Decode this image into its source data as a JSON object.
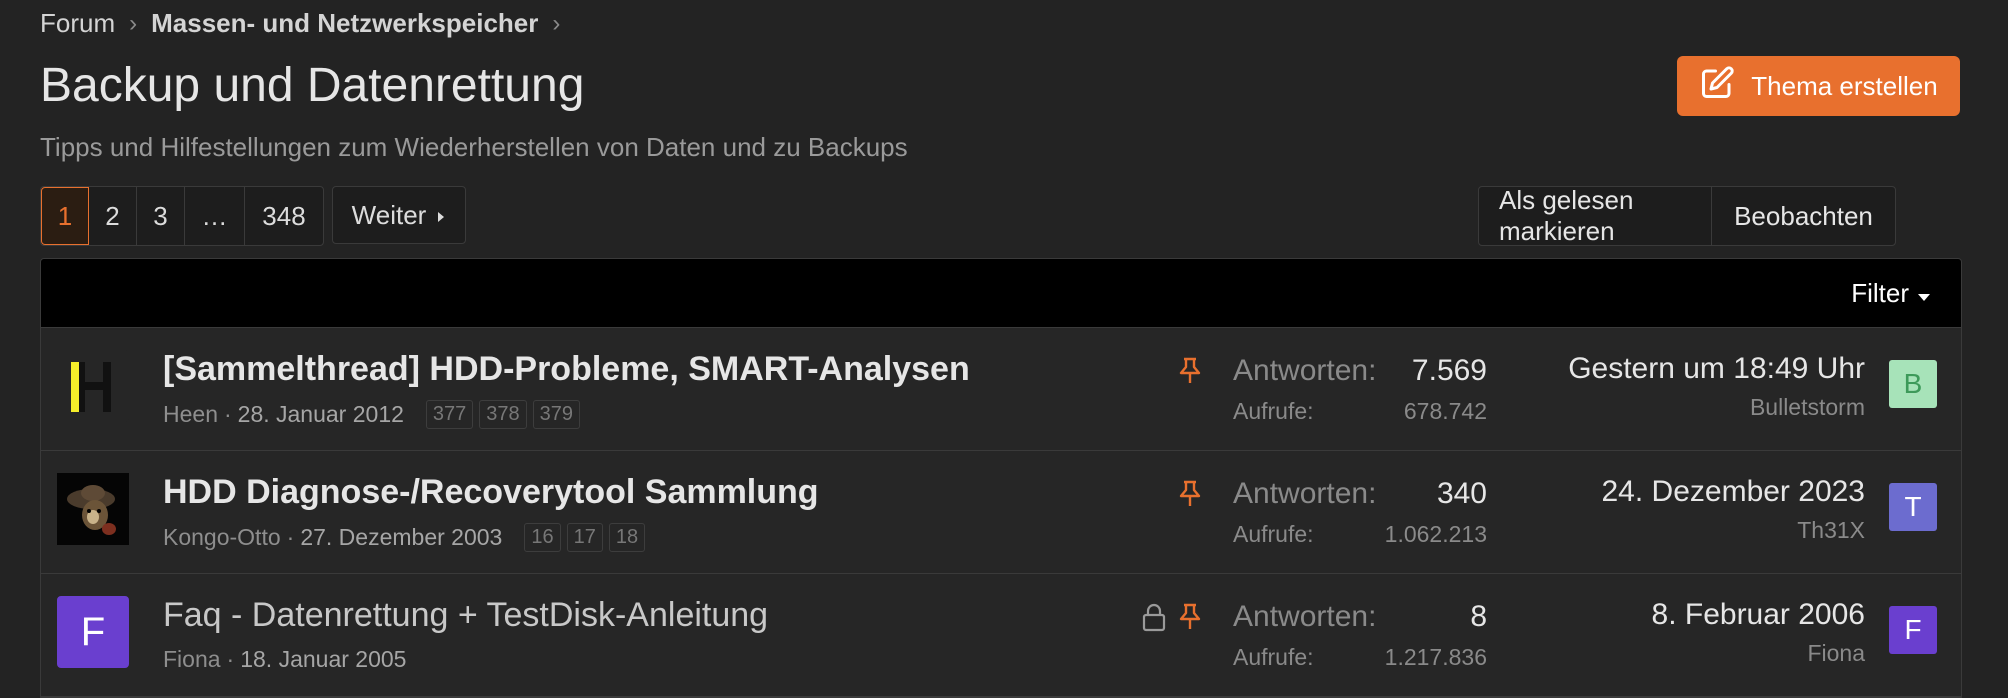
{
  "breadcrumb": {
    "items": [
      "Forum",
      "Massen- und Netzwerkspeicher"
    ]
  },
  "page": {
    "title": "Backup und Datenrettung",
    "description": "Tipps und Hilfestellungen zum Wiederherstellen von Daten und zu Backups"
  },
  "create_button": {
    "label": "Thema erstellen"
  },
  "pagination": {
    "pages": [
      "1",
      "2",
      "3",
      "…",
      "348"
    ],
    "current": "1",
    "next_label": "Weiter"
  },
  "actions": {
    "mark_read": "Als gelesen markieren",
    "watch": "Beobachten"
  },
  "filter": {
    "label": "Filter"
  },
  "stat_labels": {
    "replies": "Antworten:",
    "views": "Aufrufe:"
  },
  "threads": [
    {
      "title": "[Sammelthread] HDD-Probleme, SMART-Analysen",
      "author": "Heen",
      "date": "28. Januar 2012",
      "pages": [
        "377",
        "378",
        "379"
      ],
      "replies": "7.569",
      "views": "678.742",
      "last_date": "Gestern um 18:49 Uhr",
      "last_user": "Bulletstorm",
      "last_avatar_letter": "B",
      "last_avatar_color": "#a7e3b9",
      "pinned": true,
      "locked": false
    },
    {
      "title": "HDD Diagnose-/Recoverytool Sammlung",
      "author": "Kongo-Otto",
      "date": "27. Dezember 2003",
      "pages": [
        "16",
        "17",
        "18"
      ],
      "replies": "340",
      "views": "1.062.213",
      "last_date": "24. Dezember 2023",
      "last_user": "Th31X",
      "last_avatar_letter": "T",
      "last_avatar_color": "#6c6ccf",
      "pinned": true,
      "locked": false
    },
    {
      "title": "Faq - Datenrettung + TestDisk-Anleitung",
      "author": "Fiona",
      "date": "18. Januar 2005",
      "pages": [],
      "replies": "8",
      "views": "1.217.836",
      "last_date": "8. Februar 2006",
      "last_user": "Fiona",
      "last_avatar_letter": "F",
      "last_avatar_color": "#6a3fcf",
      "author_avatar_letter": "F",
      "pinned": true,
      "locked": true
    }
  ],
  "colors": {
    "accent": "#e8702e",
    "background": "#232323",
    "header_bar": "#000000"
  }
}
